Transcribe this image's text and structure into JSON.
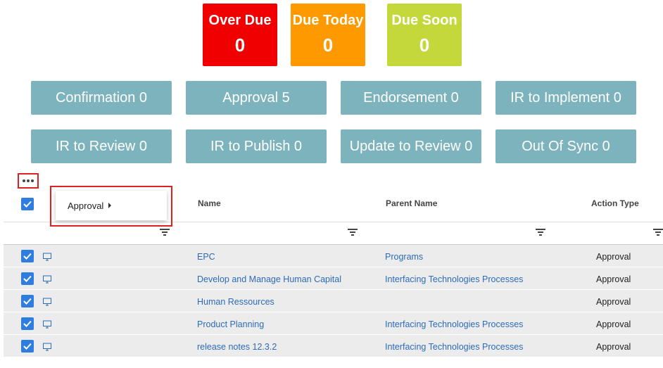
{
  "status_tiles": [
    {
      "label": "Over Due",
      "count": "0",
      "color": "#f00000"
    },
    {
      "label": "Due Today",
      "count": "0",
      "color": "#ff9900"
    },
    {
      "label": "Due Soon",
      "count": "0",
      "color": "#c4d83c"
    }
  ],
  "categories": [
    "Confirmation 0",
    "Approval 5",
    "Endorsement 0",
    "IR to Implement 0",
    "IR to Review 0",
    "IR to Publish 0",
    "Update to Review 0",
    "Out Of Sync 0"
  ],
  "category_color": "#7db3bd",
  "more_icon": "ellipsis-icon",
  "dropdown": {
    "item_label": "Approval",
    "item_icon": "caret-right-icon"
  },
  "columns": {
    "name": "Name",
    "parent": "Parent Name",
    "action": "Action Type"
  },
  "filter_icon": "filter-icon",
  "row_icon": "monitor-icon",
  "rows": [
    {
      "name": "EPC",
      "parent": "Programs",
      "action": "Approval",
      "checked": true
    },
    {
      "name": "Develop and Manage Human Capital",
      "parent": "Interfacing Technologies Processes",
      "action": "Approval",
      "checked": true
    },
    {
      "name": "Human Ressources",
      "parent": "",
      "action": "Approval",
      "checked": true
    },
    {
      "name": "Product Planning",
      "parent": "Interfacing Technologies Processes",
      "action": "Approval",
      "checked": true
    },
    {
      "name": "release notes 12.3.2",
      "parent": "Interfacing Technologies Processes",
      "action": "Approval",
      "checked": true
    }
  ],
  "header_checked": true,
  "accent_color": "#2f7de1",
  "link_color": "#2d6bb8"
}
